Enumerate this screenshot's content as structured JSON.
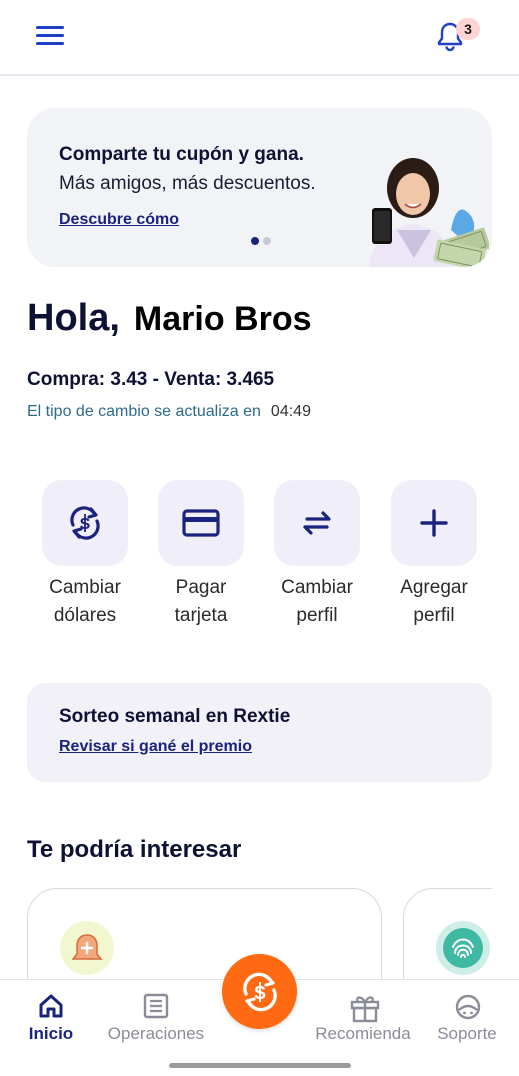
{
  "header": {
    "menu_icon": "hamburger-menu-icon",
    "notification_icon": "bell-icon",
    "notification_count": "3",
    "accent_color": "#1f3fc4",
    "badge_color": "#ffd4d4"
  },
  "promo": {
    "title": "Comparte tu cupón y gana.",
    "subtitle": "Más amigos, más descuentos.",
    "link": "Descubre cómo",
    "slide_count": 2,
    "active_slide": 1
  },
  "greeting": {
    "hello": "Hola,",
    "name": "Mario Bros"
  },
  "exchange": {
    "rates": "Compra: 3.43 - Venta: 3.465",
    "update_label": "El tipo de cambio se actualiza en",
    "countdown": "04:49"
  },
  "actions": [
    {
      "line1": "Cambiar",
      "line2": "dólares",
      "icon": "currency-exchange-icon"
    },
    {
      "line1": "Pagar",
      "line2": "tarjeta",
      "icon": "credit-card-icon"
    },
    {
      "line1": "Cambiar",
      "line2": "perfil",
      "icon": "swap-arrows-icon"
    },
    {
      "line1": "Agregar",
      "line2": "perfil",
      "icon": "plus-icon"
    }
  ],
  "raffle": {
    "title": "Sorteo semanal en Rextie",
    "link": "Revisar si gané el premio"
  },
  "interest": {
    "title": "Te podría interesar"
  },
  "bottom_nav": {
    "items": [
      {
        "label": "Inicio",
        "icon": "home-icon",
        "active": true
      },
      {
        "label": "Operaciones",
        "icon": "list-document-icon",
        "active": false
      },
      {
        "label": "Recomienda",
        "icon": "gift-icon",
        "active": false
      },
      {
        "label": "Soporte",
        "icon": "support-agent-icon",
        "active": false
      }
    ],
    "center_button_icon": "exchange-fab-icon",
    "center_button_color": "#ff6a13"
  }
}
